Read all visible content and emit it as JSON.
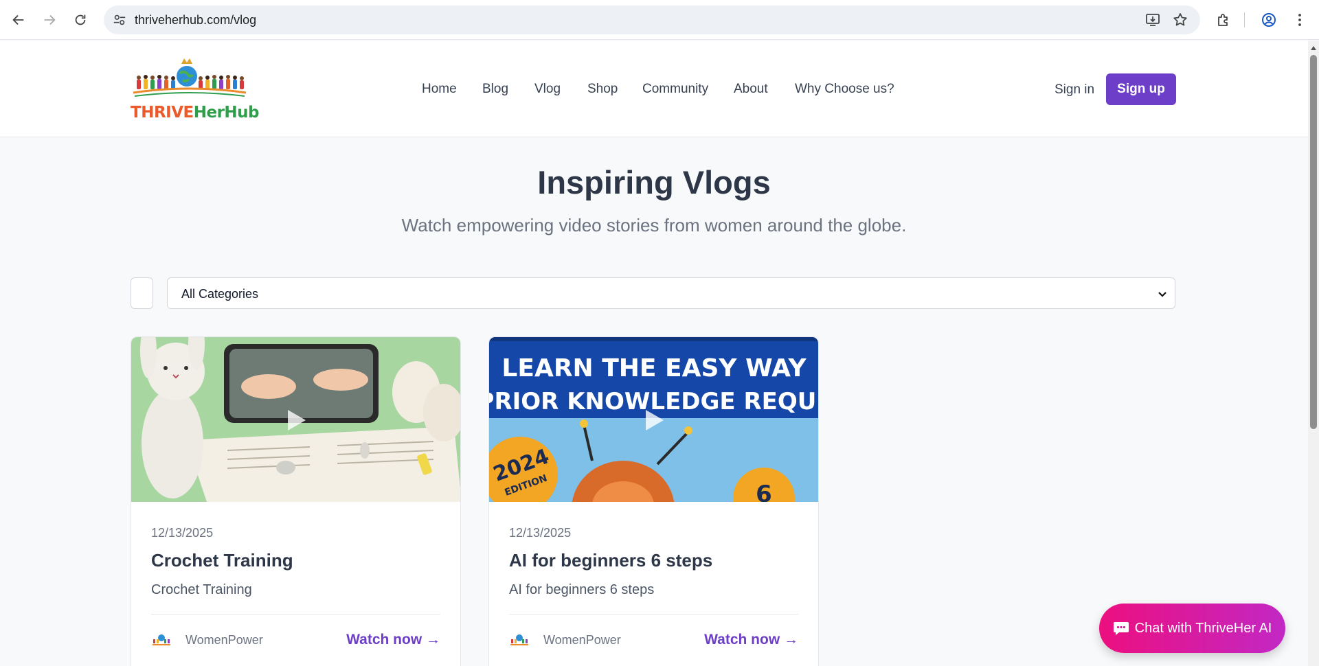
{
  "browser": {
    "url": "thriveherhub.com/vlog"
  },
  "site": {
    "logo_text_part1": "THRIVE",
    "logo_text_part2": "HerHub",
    "nav": [
      "Home",
      "Blog",
      "Vlog",
      "Shop",
      "Community",
      "About",
      "Why Choose us?"
    ],
    "signin_label": "Sign in",
    "signup_label": "Sign up",
    "accent_color": "#6d3fc8"
  },
  "hero": {
    "title": "Inspiring Vlogs",
    "subtitle": "Watch empowering video stories from women around the globe."
  },
  "filter": {
    "category_selected": "All Categories"
  },
  "vlogs": [
    {
      "date": "12/13/2025",
      "title": "Crochet Training",
      "description": "Crochet Training",
      "author": "WomenPower",
      "watch_label": "Watch now →",
      "thumbnail": "crochet-bunny-thumbnail"
    },
    {
      "date": "12/13/2025",
      "title": "AI for beginners 6 steps",
      "description": "AI for beginners 6 steps",
      "author": "WomenPower",
      "watch_label": "Watch now →",
      "thumbnail": "ai-beginners-thumbnail",
      "thumb_line1": "LEARN THE EASY WAY",
      "thumb_line2": "NO PRIOR KNOWLEDGE REQUIRED",
      "thumb_badge": "2024",
      "thumb_badge_sub": "EDITION",
      "thumb_number": "6"
    }
  ],
  "chat": {
    "label": "Chat with ThriveHer AI",
    "icon": "chat-bubble-icon"
  }
}
